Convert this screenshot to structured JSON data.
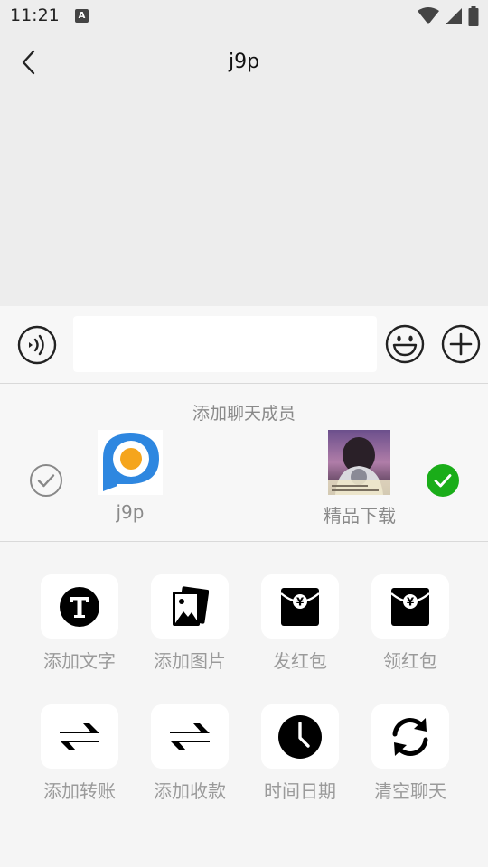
{
  "status_bar": {
    "time": "11:21",
    "notification_letter": "A"
  },
  "header": {
    "title": "j9p"
  },
  "input": {
    "value": "",
    "placeholder": ""
  },
  "members": {
    "heading": "添加聊天成员",
    "left": {
      "name": "j9p",
      "selected": false
    },
    "right": {
      "name": "精品下载",
      "selected": true
    }
  },
  "tools": [
    {
      "label": "添加文字",
      "icon": "text-t-icon"
    },
    {
      "label": "添加图片",
      "icon": "image-icon"
    },
    {
      "label": "发红包",
      "icon": "red-packet-icon"
    },
    {
      "label": "领红包",
      "icon": "red-packet-icon"
    },
    {
      "label": "添加转账",
      "icon": "transfer-arrows-icon"
    },
    {
      "label": "添加收款",
      "icon": "transfer-arrows-icon"
    },
    {
      "label": "时间日期",
      "icon": "clock-icon"
    },
    {
      "label": "清空聊天",
      "icon": "refresh-icon"
    }
  ],
  "colors": {
    "check_selected": "#1aad19",
    "background": "#ededed",
    "panel": "#f7f7f7"
  }
}
